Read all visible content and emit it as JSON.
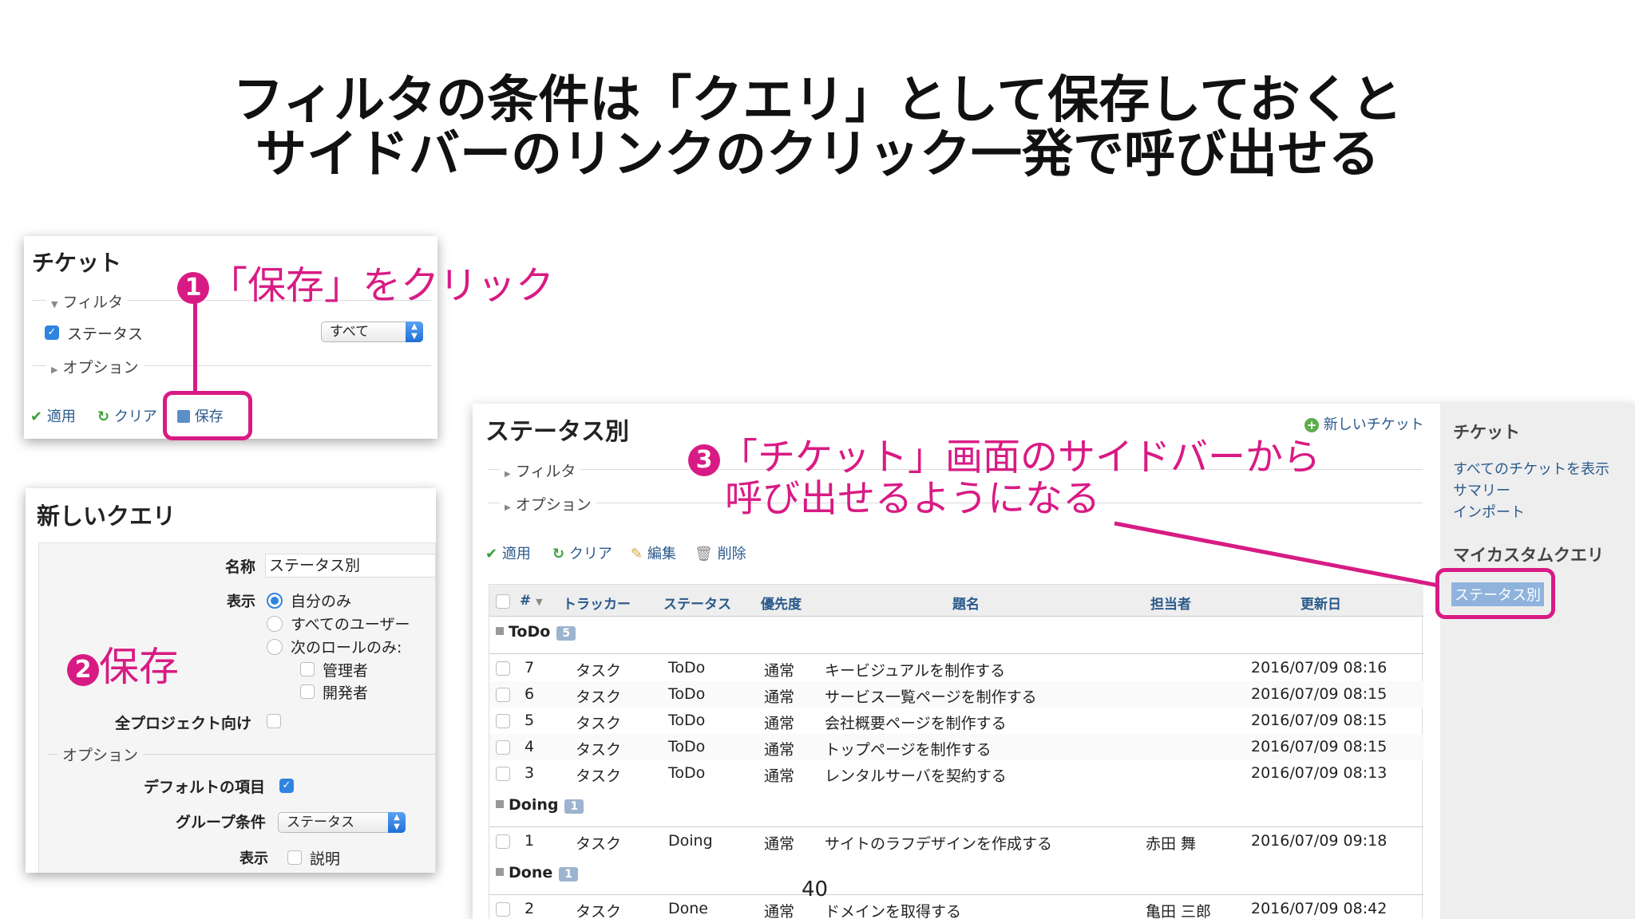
{
  "slide": {
    "title_line1": "フィルタの条件は「クエリ」として保存しておくと",
    "title_line2": "サイドバーのリンクのクリック一発で呼び出せる",
    "page_number": "40"
  },
  "filter_panel": {
    "title": "チケット",
    "filter_label": "フィルタ",
    "status_label": "ステータス",
    "status_select_value": "すべて",
    "options_label": "オプション",
    "apply_label": "適用",
    "clear_label": "クリア",
    "save_label": "保存"
  },
  "annotations": {
    "step1_num": "1",
    "step1_text": "「保存」をクリック",
    "step2_num": "2",
    "step2_text": "保存",
    "step3_num": "3",
    "step3_line1": "「チケット」画面のサイドバーから",
    "step3_line2": "呼び出せるようになる"
  },
  "query_panel": {
    "title": "新しいクエリ",
    "name_label": "名称",
    "name_value": "ステータス別",
    "visibility_label": "表示",
    "vis_opt1": "自分のみ",
    "vis_opt2": "すべてのユーザー",
    "vis_opt3": "次のロールのみ:",
    "role1": "管理者",
    "role2": "開発者",
    "all_projects_label": "全プロジェクト向け",
    "options_label": "オプション",
    "default_columns_label": "デフォルトの項目",
    "group_by_label": "グループ条件",
    "group_by_value": "ステータス",
    "show_label": "表示",
    "show_desc_label": "説明"
  },
  "issues_view": {
    "title": "ステータス別",
    "new_issue_label": "新しいチケット",
    "filter_label": "フィルタ",
    "options_label": "オプション",
    "apply_label": "適用",
    "clear_label": "クリア",
    "edit_label": "編集",
    "delete_label": "削除",
    "columns": [
      "#",
      "トラッカー",
      "ステータス",
      "優先度",
      "題名",
      "担当者",
      "更新日"
    ],
    "groups": [
      {
        "name": "ToDo",
        "count": "5",
        "rows": [
          {
            "id": "7",
            "tracker": "タスク",
            "status": "ToDo",
            "priority": "通常",
            "subject": "キービジュアルを制作する",
            "assignee": "",
            "updated": "2016/07/09 08:16"
          },
          {
            "id": "6",
            "tracker": "タスク",
            "status": "ToDo",
            "priority": "通常",
            "subject": "サービス一覧ページを制作する",
            "assignee": "",
            "updated": "2016/07/09 08:15"
          },
          {
            "id": "5",
            "tracker": "タスク",
            "status": "ToDo",
            "priority": "通常",
            "subject": "会社概要ページを制作する",
            "assignee": "",
            "updated": "2016/07/09 08:15"
          },
          {
            "id": "4",
            "tracker": "タスク",
            "status": "ToDo",
            "priority": "通常",
            "subject": "トップページを制作する",
            "assignee": "",
            "updated": "2016/07/09 08:15"
          },
          {
            "id": "3",
            "tracker": "タスク",
            "status": "ToDo",
            "priority": "通常",
            "subject": "レンタルサーバを契約する",
            "assignee": "",
            "updated": "2016/07/09 08:13"
          }
        ]
      },
      {
        "name": "Doing",
        "count": "1",
        "rows": [
          {
            "id": "1",
            "tracker": "タスク",
            "status": "Doing",
            "priority": "通常",
            "subject": "サイトのラフデザインを作成する",
            "assignee": "赤田 舞",
            "updated": "2016/07/09 09:18"
          }
        ]
      },
      {
        "name": "Done",
        "count": "1",
        "rows": [
          {
            "id": "2",
            "tracker": "タスク",
            "status": "Done",
            "priority": "通常",
            "subject": "ドメインを取得する",
            "assignee": "亀田 三郎",
            "updated": "2016/07/09 08:42"
          }
        ]
      }
    ]
  },
  "sidebar": {
    "section_title": "チケット",
    "link_all": "すべてのチケットを表示",
    "link_summary": "サマリー",
    "link_import": "インポート",
    "custom_query_title": "マイカスタムクエリ",
    "custom_query_item": "ステータス別"
  },
  "colors": {
    "accent_pink": "#d81b84",
    "link_blue": "#2a5a8c",
    "sidebar_bg": "#eeeeee",
    "selected_query_bg": "#8fb3dc"
  }
}
